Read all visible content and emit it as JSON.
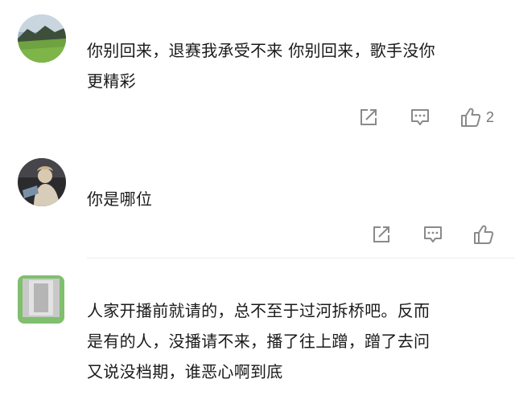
{
  "comments": [
    {
      "avatar_icon": "landscape-avatar",
      "text": "你别回来，退赛我承受不来 你别回来，歌手没你\n更精彩",
      "actions": {
        "share_icon": "share-icon",
        "reply_icon": "comment-icon",
        "like_icon": "thumbs-up-icon",
        "like_count": "2"
      }
    },
    {
      "avatar_icon": "person-photo-avatar",
      "text": "你是哪位",
      "actions": {
        "share_icon": "share-icon",
        "reply_icon": "comment-icon",
        "like_icon": "thumbs-up-icon",
        "like_count": ""
      }
    },
    {
      "avatar_icon": "gray-green-avatar",
      "text": "人家开播前就请的，总不至于过河拆桥吧。反而\n是有的人，没播请不来，播了往上蹭，蹭了去问\n又说没档期，谁恶心啊到底",
      "actions": null
    }
  ],
  "colors": {
    "icon_gray": "#8a8a8a",
    "text": "#1a1a1a",
    "divider": "#ececec"
  }
}
